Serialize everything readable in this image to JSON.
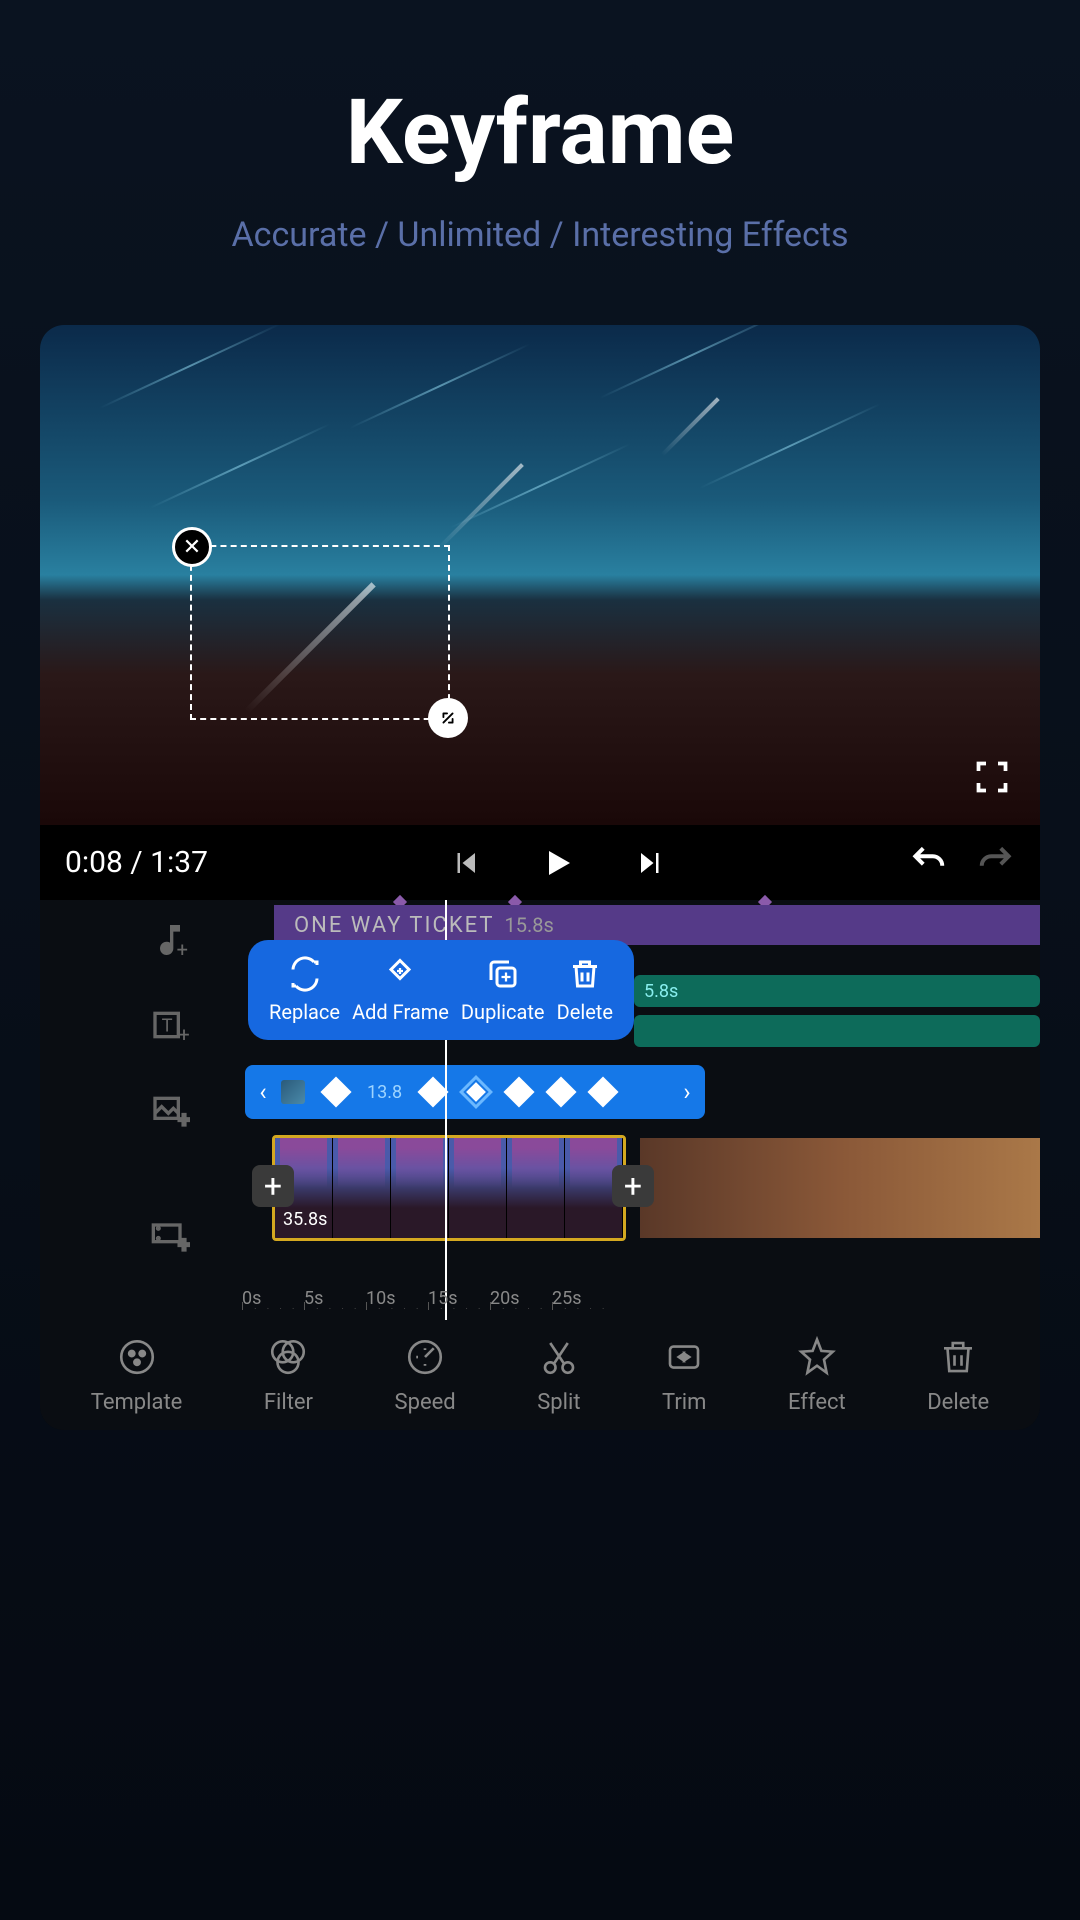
{
  "title": "Keyframe",
  "subtitle": "Accurate / Unlimited / Interesting Effects",
  "playback": {
    "current_time": "0:08",
    "duration": "1:37",
    "timecode": "0:08 / 1:37"
  },
  "audio_track": {
    "name": "ONE WAY TICKET",
    "duration": "15.8s"
  },
  "green_track": {
    "label": "5.8s"
  },
  "context_menu": [
    {
      "label": "Replace",
      "icon": "replace-icon"
    },
    {
      "label": "Add Frame",
      "icon": "add-frame-icon"
    },
    {
      "label": "Duplicate",
      "icon": "duplicate-icon"
    },
    {
      "label": "Delete",
      "icon": "delete-icon"
    }
  ],
  "keyframe_track": {
    "duration": "13.8"
  },
  "video_clip": {
    "duration": "35.8s"
  },
  "ruler": [
    "0s",
    "5s",
    "10s",
    "15s",
    "20s",
    "25s"
  ],
  "tools": [
    {
      "label": "Template",
      "icon": "template-icon"
    },
    {
      "label": "Filter",
      "icon": "filter-icon"
    },
    {
      "label": "Speed",
      "icon": "speed-icon"
    },
    {
      "label": "Split",
      "icon": "split-icon"
    },
    {
      "label": "Trim",
      "icon": "trim-icon"
    },
    {
      "label": "Effect",
      "icon": "effect-icon"
    },
    {
      "label": "Delete",
      "icon": "delete-tool-icon"
    }
  ],
  "plus": "+"
}
